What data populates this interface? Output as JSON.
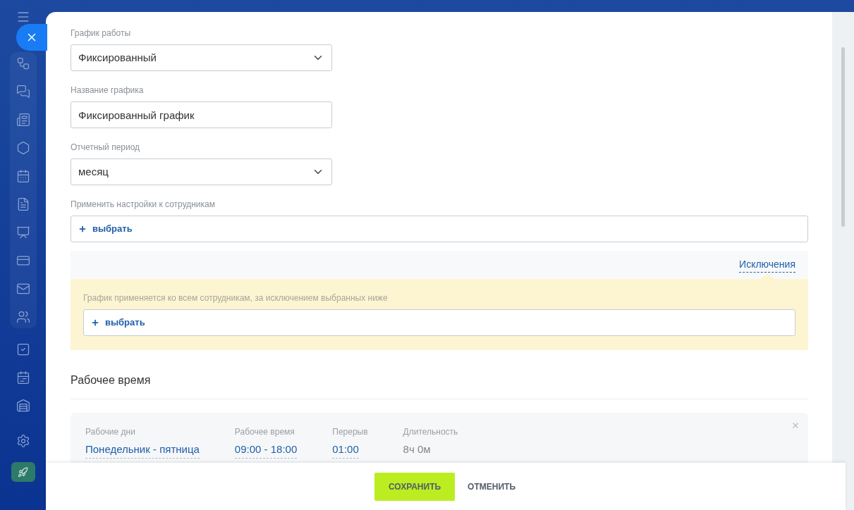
{
  "fields": [
    {
      "kind": "select",
      "label": "График работы",
      "value": "Фиксированный"
    },
    {
      "kind": "input",
      "label": "Название графика",
      "value": "Фиксированный график"
    },
    {
      "kind": "select",
      "label": "Отчетный период",
      "value": "месяц"
    }
  ],
  "employees": {
    "label": "Применить настройки к сотрудникам",
    "button": "выбрать"
  },
  "exceptions": {
    "tab": "Исключения",
    "note": "График применяется ко всем сотрудникам, за исключением выбранных ниже",
    "button": "выбрать"
  },
  "working_time": {
    "title": "Рабочее время",
    "rows": [
      {
        "columns": [
          {
            "kind": "link",
            "label": "Рабочие дни",
            "value": "Понедельник - пятница"
          },
          {
            "kind": "link",
            "label": "Рабочее время",
            "value": "09:00 - 18:00"
          },
          {
            "kind": "link",
            "label": "Перерыв",
            "value": "01:00"
          },
          {
            "kind": "plain",
            "label": "Длительность",
            "value": "8ч 0м"
          }
        ]
      }
    ]
  },
  "footer": {
    "save": "СОХРАНИТЬ",
    "cancel": "ОТМЕНИТЬ"
  }
}
